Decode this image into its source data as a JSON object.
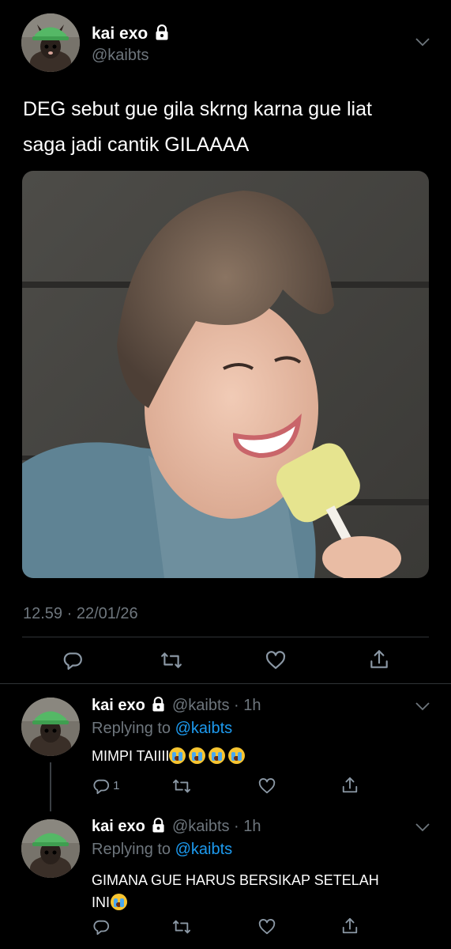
{
  "main_tweet": {
    "display_name": "kai exo",
    "handle": "@kaibts",
    "text": "DEG sebut gue gila skrng karna gue liat saga jadi cantik GILAAAA",
    "timestamp": "12.59 · 22/01/26",
    "image_alt": "photo of person eating a popsicle"
  },
  "replies": [
    {
      "display_name": "kai exo",
      "handle_time": "@kaibts · 1h",
      "replying_to_label": "Replying to",
      "replying_to_handle": "@kaibts",
      "text": "MIMPI TAIIII",
      "emoji_count": 4,
      "reply_count": "1"
    },
    {
      "display_name": "kai exo",
      "handle_time": "@kaibts · 1h",
      "replying_to_label": "Replying to",
      "replying_to_handle": "@kaibts",
      "text_line1": "GIMANA GUE HARUS BERSIKAP SETELAH",
      "text_line2": "INI",
      "emoji_count": 1
    }
  ],
  "icons": {
    "reply": "reply-icon",
    "retweet": "retweet-icon",
    "like": "heart-icon",
    "share": "share-icon",
    "lock": "lock-icon",
    "more": "chevron-down-icon"
  },
  "colors": {
    "background": "#000000",
    "link": "#1d9bf0",
    "muted": "#6e767d",
    "divider": "#2f3336"
  }
}
